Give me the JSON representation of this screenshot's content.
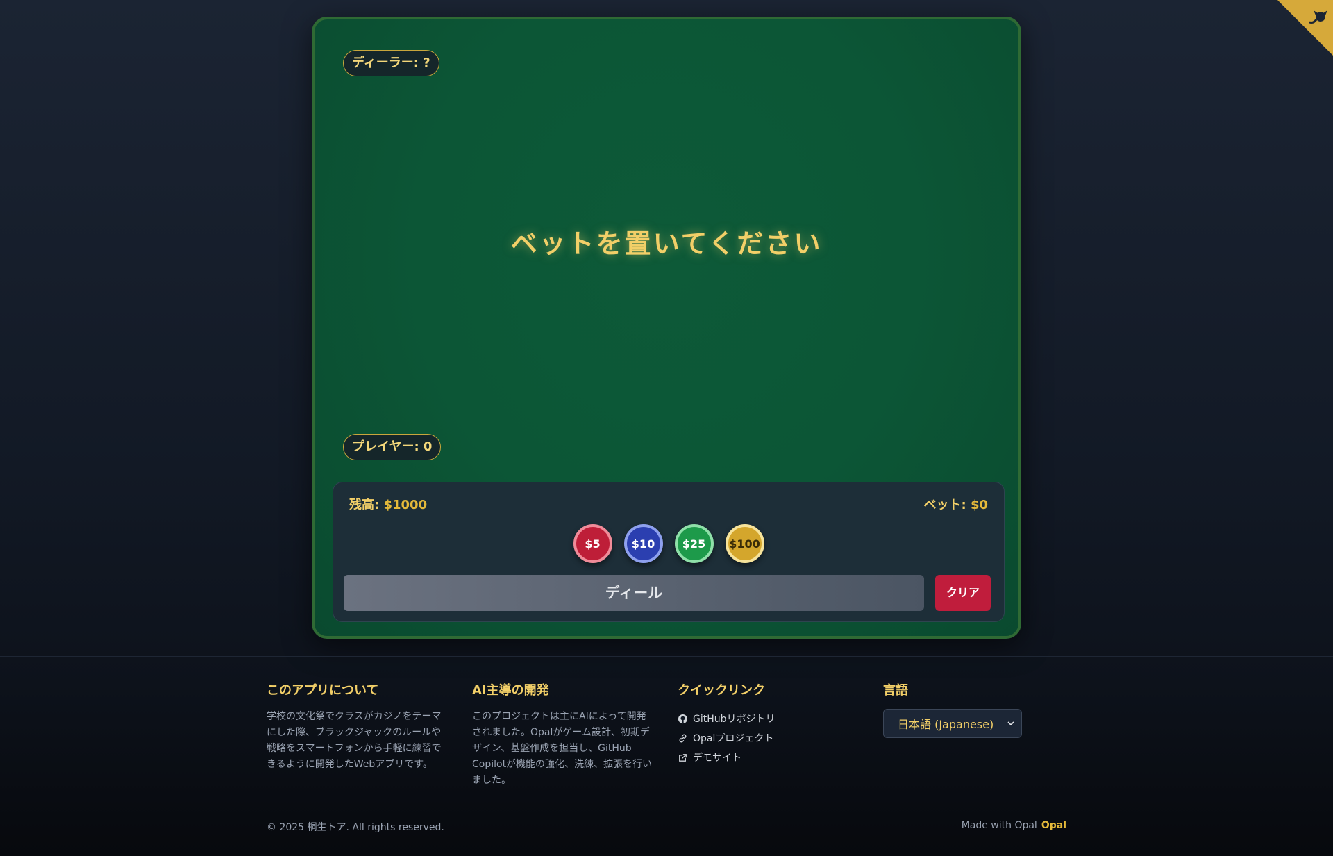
{
  "game": {
    "dealer_label": "ディーラー: ?",
    "player_label": "プレイヤー: 0",
    "message": "ベットを置いてください",
    "balance_label": "残高:",
    "balance_value": "$1000",
    "bet_label": "ベット:",
    "bet_value": "$0",
    "chips": [
      "$5",
      "$10",
      "$25",
      "$100"
    ],
    "deal_label": "ディール",
    "clear_label": "クリア"
  },
  "footer": {
    "about_title": "このアプリについて",
    "about_text": "学校の文化祭でクラスがカジノをテーマにした際、ブラックジャックのルールや戦略をスマートフォンから手軽に練習できるように開発したWebアプリです。",
    "ai_title": "AI主導の開発",
    "ai_text": "このプロジェクトは主にAIによって開発されました。Opalがゲーム設計、初期デザイン、基盤作成を担当し、GitHub Copilotが機能の強化、洗練、拡張を行いました。",
    "links_title": "クイックリンク",
    "links": [
      "GitHubリポジトリ",
      "Opalプロジェクト",
      "デモサイト"
    ],
    "language_title": "言語",
    "language_selected": "日本語 (Japanese)",
    "copyright": "© 2025 桐生トア. All rights reserved.",
    "made_with": "Made with Opal",
    "made_with_brand": "Opal"
  },
  "colors": {
    "felt": "#0c5636",
    "gold": "#f2cf68",
    "accent_red": "#c01d3c"
  }
}
